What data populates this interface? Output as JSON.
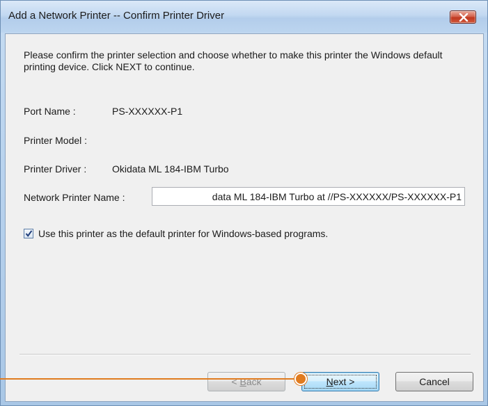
{
  "window": {
    "title": "Add a Network Printer -- Confirm Printer Driver"
  },
  "instructions": "Please confirm the printer selection and choose whether to make this printer the Windows default printing device. Click NEXT to continue.",
  "fields": {
    "port_name_label": "Port Name :",
    "port_name_value": "PS-XXXXXX-P1",
    "printer_model_label": "Printer Model :",
    "printer_driver_label": "Printer Driver :",
    "printer_driver_value": "Okidata ML 184-IBM Turbo",
    "network_name_label": "Network Printer Name :",
    "network_name_value": "data ML 184-IBM Turbo at //PS-XXXXXX/PS-XXXXXX-P1"
  },
  "default_printer": {
    "label": "Use this printer as the default printer for Windows-based programs.",
    "checked": true
  },
  "buttons": {
    "back_prefix": "< ",
    "back_mnemonic": "B",
    "back_rest": "ack",
    "next_mnemonic": "N",
    "next_rest": "ext >",
    "cancel": "Cancel"
  },
  "icons": {
    "close": "close-x-icon",
    "check": "checkmark-icon"
  },
  "colors": {
    "callout": "#e07b1f",
    "close_button": "#c0381f",
    "default_button_border": "#3c7fb1"
  }
}
